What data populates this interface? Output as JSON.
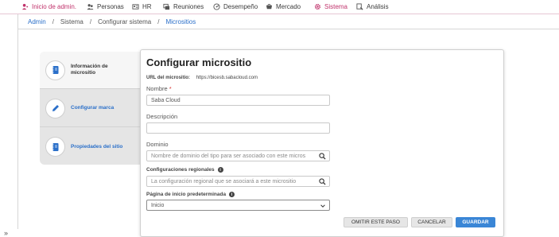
{
  "nav": {
    "items": [
      {
        "label": "Inicio de admin.",
        "icon": "admin-home-icon"
      },
      {
        "label": "Personas",
        "icon": "people-icon"
      },
      {
        "label": "HR",
        "icon": "hr-icon"
      },
      {
        "label": "Reuniones",
        "icon": "meetings-icon"
      },
      {
        "label": "Desempeño",
        "icon": "performance-icon"
      },
      {
        "label": "Mercado",
        "icon": "marketplace-icon"
      },
      {
        "label": "Sistema",
        "icon": "gear-icon"
      },
      {
        "label": "Análisis",
        "icon": "analytics-icon"
      }
    ],
    "accent": "#c0326b"
  },
  "breadcrumb": {
    "items": [
      "Admin",
      "Sistema",
      "Configurar sistema",
      "Micrositios"
    ]
  },
  "tabs": [
    {
      "label": "Información de micrositio",
      "icon": "notebook-icon"
    },
    {
      "label": "Configurar marca",
      "icon": "pencil-icon"
    },
    {
      "label": "Propiedades del sitio",
      "icon": "notebook-icon"
    }
  ],
  "form": {
    "title": "Configurar micrositio",
    "url_label": "URL del micrositio:",
    "url_value": "https://bicesb.sabacloud.com",
    "nombre_label": "Nombre",
    "nombre_value": "Saba Cloud",
    "descripcion_label": "Descripción",
    "descripcion_value": "",
    "dominio_label": "Dominio",
    "dominio_placeholder": "Nombre de dominio del tipo para ser asociado con este micros",
    "regional_label": "Configuraciones regionales",
    "regional_placeholder": "La configuración regional que se asociará a este micrositio",
    "pagina_label": "Página de inicio predeterminada",
    "pagina_value": "Inicio"
  },
  "buttons": {
    "skip": "OMITIR ESTE PASO",
    "cancel": "CANCELAR",
    "save": "GUARDAR"
  },
  "sidebar_toggle": "»",
  "colors": {
    "primary": "#3a86d6",
    "link": "#2a6fc9",
    "required": "#d8322f"
  }
}
